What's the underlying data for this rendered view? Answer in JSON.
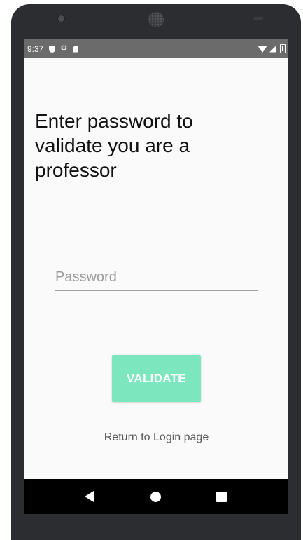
{
  "status_bar": {
    "time": "9:37",
    "icons": [
      "shield-icon",
      "gear-icon",
      "sd-card-icon",
      "wifi-icon",
      "signal-icon",
      "battery-icon"
    ],
    "background": "#6b6b6b"
  },
  "main": {
    "heading": "Enter password to validate you are a professor",
    "password_placeholder": "Password",
    "password_value": "",
    "validate_label": "VALIDATE",
    "return_link": "Return to Login page"
  },
  "nav_bar": {
    "icons": [
      "back-icon",
      "home-icon",
      "recents-icon"
    ]
  },
  "colors": {
    "accent": "#7ce6bf",
    "screen_bg": "#fafafa",
    "text": "#111111"
  }
}
